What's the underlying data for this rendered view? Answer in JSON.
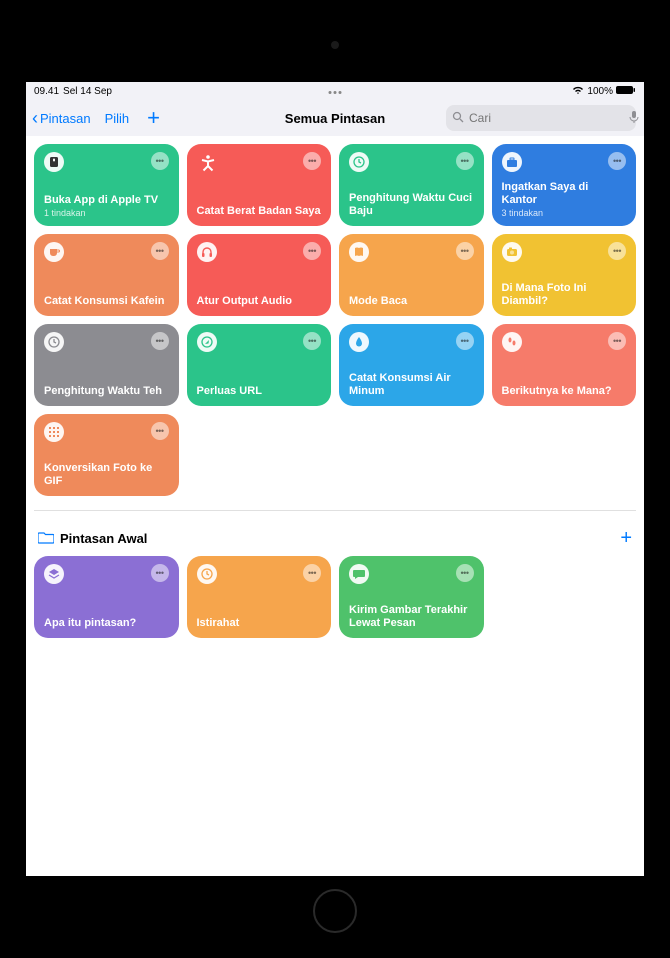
{
  "status_bar": {
    "time": "09.41",
    "date": "Sel 14 Sep",
    "battery": "100%"
  },
  "nav": {
    "back": "Pintasan",
    "select": "Pilih",
    "title": "Semua Pintasan",
    "search_placeholder": "Cari"
  },
  "shortcuts": [
    {
      "title": "Buka App di Apple TV",
      "sub": "1 tindakan",
      "color": "#2bc48a",
      "icon": "appletv"
    },
    {
      "title": "Catat Berat Badan Saya",
      "sub": "",
      "color": "#f65b57",
      "icon": "accessibility"
    },
    {
      "title": "Penghitung Waktu Cuci Baju",
      "sub": "",
      "color": "#2bc48a",
      "icon": "clock"
    },
    {
      "title": "Ingatkan Saya di Kantor",
      "sub": "3 tindakan",
      "color": "#2f7de0",
      "icon": "briefcase"
    },
    {
      "title": "Catat Konsumsi Kafein",
      "sub": "",
      "color": "#ef8a5b",
      "icon": "cup"
    },
    {
      "title": "Atur Output Audio",
      "sub": "",
      "color": "#f65b57",
      "icon": "headphones"
    },
    {
      "title": "Mode Baca",
      "sub": "",
      "color": "#f6a54c",
      "icon": "book"
    },
    {
      "title": "Di Mana Foto Ini Diambil?",
      "sub": "",
      "color": "#f1c232",
      "icon": "camera"
    },
    {
      "title": "Penghitung Waktu Teh",
      "sub": "",
      "color": "#8c8c91",
      "icon": "clock"
    },
    {
      "title": "Perluas URL",
      "sub": "",
      "color": "#2bc48a",
      "icon": "safari"
    },
    {
      "title": "Catat Konsumsi Air Minum",
      "sub": "",
      "color": "#2ca6e8",
      "icon": "water"
    },
    {
      "title": "Berikutnya ke Mana?",
      "sub": "",
      "color": "#f67b6a",
      "icon": "footprints"
    },
    {
      "title": "Konversikan Foto ke GIF",
      "sub": "",
      "color": "#ef8a5b",
      "icon": "grid"
    }
  ],
  "section": {
    "title": "Pintasan Awal"
  },
  "starter_shortcuts": [
    {
      "title": "Apa itu pintasan?",
      "sub": "",
      "color": "#8b6fd4",
      "icon": "layers"
    },
    {
      "title": "Istirahat",
      "sub": "",
      "color": "#f6a54c",
      "icon": "clock"
    },
    {
      "title": "Kirim Gambar Terakhir Lewat Pesan",
      "sub": "",
      "color": "#4fc26b",
      "icon": "chat"
    }
  ]
}
